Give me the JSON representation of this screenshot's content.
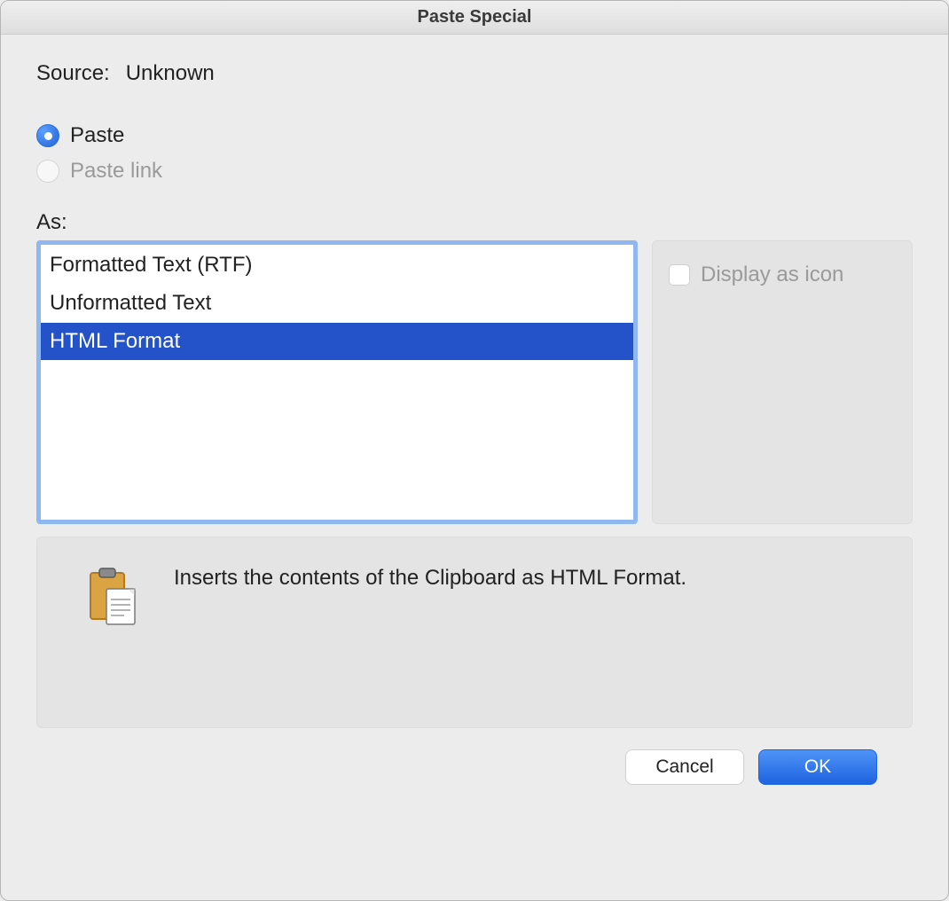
{
  "window": {
    "title": "Paste Special"
  },
  "source": {
    "label": "Source:",
    "value": "Unknown"
  },
  "radios": {
    "paste": {
      "label": "Paste",
      "selected": true
    },
    "paste_link": {
      "label": "Paste link",
      "disabled": true
    }
  },
  "as_label": "As:",
  "list": {
    "items": [
      {
        "label": "Formatted Text (RTF)",
        "selected": false
      },
      {
        "label": "Unformatted Text",
        "selected": false
      },
      {
        "label": "HTML Format",
        "selected": true
      }
    ]
  },
  "display_as_icon": {
    "label": "Display as icon",
    "disabled": true,
    "checked": false
  },
  "description": {
    "text": "Inserts the contents of the Clipboard as HTML Format."
  },
  "buttons": {
    "cancel": "Cancel",
    "ok": "OK"
  }
}
